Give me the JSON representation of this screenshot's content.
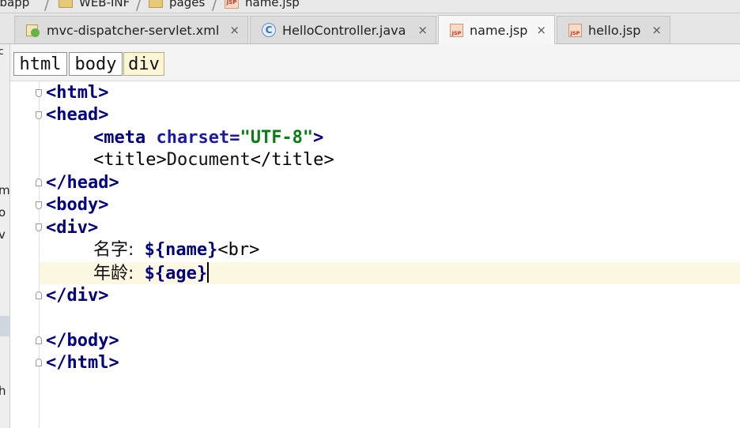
{
  "breadcrumb": [
    {
      "label": "webapp",
      "icon": "folder-icon"
    },
    {
      "label": "WEB-INF",
      "icon": "folder-icon"
    },
    {
      "label": "pages",
      "icon": "folder-icon"
    },
    {
      "label": "name.jsp",
      "icon": "jsp-file-icon"
    }
  ],
  "tabs": [
    {
      "label": "mvc-dispatcher-servlet.xml",
      "icon": "xml-spring-icon",
      "active": false
    },
    {
      "label": "HelloController.java",
      "icon": "java-class-icon",
      "active": false
    },
    {
      "label": "name.jsp",
      "icon": "jsp-file-icon",
      "active": true
    },
    {
      "label": "hello.jsp",
      "icon": "jsp-file-icon",
      "active": false
    }
  ],
  "tab_close_glyph": "×",
  "tag_path": [
    "html",
    "body",
    "div"
  ],
  "left_panel_fragments": [
    "c",
    "m",
    "o",
    "v",
    "h"
  ],
  "code": {
    "l1": {
      "open": "<",
      "name": "html",
      "close": ">"
    },
    "l2": {
      "open": "<",
      "name": "head",
      "close": ">"
    },
    "l3": {
      "open": "<",
      "name": "meta",
      "attr": "charset",
      "eq": "=",
      "value": "\"UTF-8\"",
      "close": ">"
    },
    "l4": {
      "open": "<",
      "name": "title",
      "close": ">",
      "text": "Document",
      "end_open": "</",
      "end_name": "title",
      "end_close": ">"
    },
    "l5": {
      "open": "</",
      "name": "head",
      "close": ">"
    },
    "l6": {
      "open": "<",
      "name": "body",
      "close": ">"
    },
    "l7": {
      "open": "<",
      "name": "div",
      "close": ">"
    },
    "l8": {
      "label": "名字:",
      "el": "${name}",
      "br_open": "<",
      "br_name": "br",
      "br_close": ">"
    },
    "l9": {
      "label": "年龄:",
      "el": "${age}"
    },
    "l10": {
      "open": "</",
      "name": "div",
      "close": ">"
    },
    "l12": {
      "open": "</",
      "name": "body",
      "close": ">"
    },
    "l13": {
      "open": "</",
      "name": "html",
      "close": ">"
    }
  },
  "colors": {
    "tag": "#000080",
    "attribute": "#1a1aa6",
    "string": "#0a7d12",
    "current_line": "#fdf8e2"
  }
}
